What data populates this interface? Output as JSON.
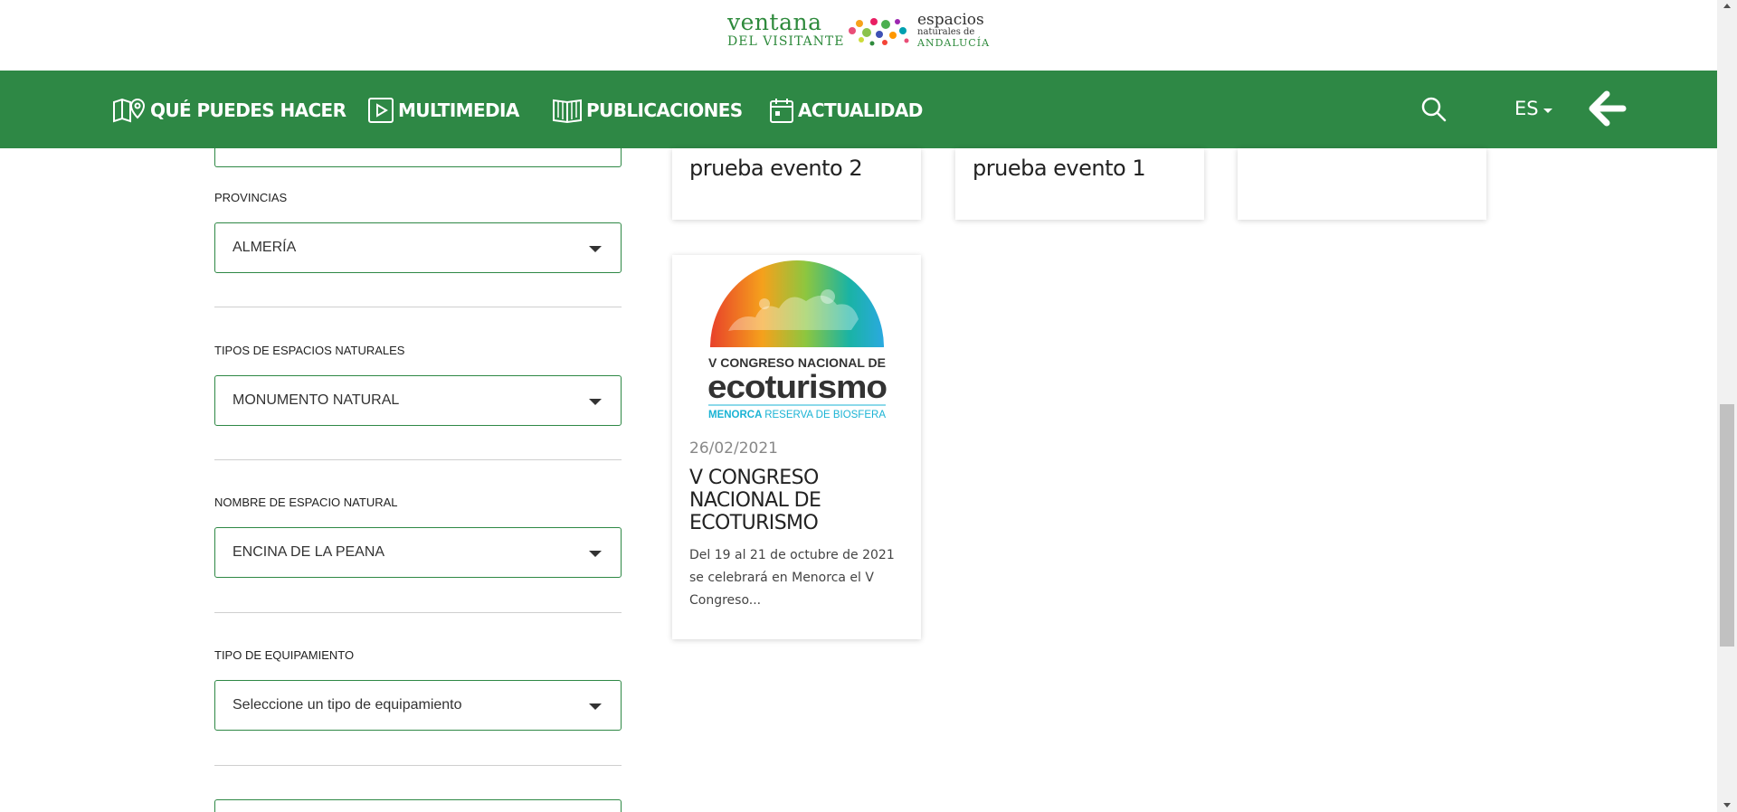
{
  "header": {
    "logo": {
      "line1": "ventana",
      "line2": "DEL VISITANTE",
      "right1": "espacios",
      "right2": "naturales de",
      "right3": "ANDALUCÍA"
    }
  },
  "nav": {
    "items": [
      {
        "label": "QUÉ PUEDES HACER",
        "icon": "map-pin-icon"
      },
      {
        "label": "MULTIMEDIA",
        "icon": "play-icon"
      },
      {
        "label": "PUBLICACIONES",
        "icon": "book-icon"
      },
      {
        "label": "ACTUALIDAD",
        "icon": "calendar-icon"
      }
    ],
    "search_icon": "search-icon",
    "language": "ES",
    "back_icon": "arrow-left-icon"
  },
  "filters": [
    {
      "label": "PROVINCIAS",
      "value": "ALMERÍA"
    },
    {
      "label": "TIPOS DE ESPACIOS NATURALES",
      "value": "MONUMENTO NATURAL"
    },
    {
      "label": "NOMBRE DE ESPACIO NATURAL",
      "value": "ENCINA DE LA PEANA"
    },
    {
      "label": "TIPO DE EQUIPAMIENTO",
      "value": "Seleccione un tipo de equipamiento"
    }
  ],
  "cards_top": [
    {
      "title": "prueba evento 2"
    },
    {
      "title": "prueba evento 1"
    },
    {
      "title": ""
    }
  ],
  "card_main": {
    "image_text": {
      "line1": "V CONGRESO NACIONAL DE",
      "line2": "ecoturismo",
      "line3_a": "MENORCA",
      "line3_b": "RESERVA DE BIOSFERA"
    },
    "date": "26/02/2021",
    "title": "V CONGRESO NACIONAL DE ECOTURISMO",
    "description": "Del 19 al 21 de octubre de 2021 se celebrará en Menorca el V Congreso..."
  },
  "colors": {
    "nav_green": "#2e8845",
    "logo_green": "#2e8a3c",
    "border_green": "#2e8845"
  }
}
